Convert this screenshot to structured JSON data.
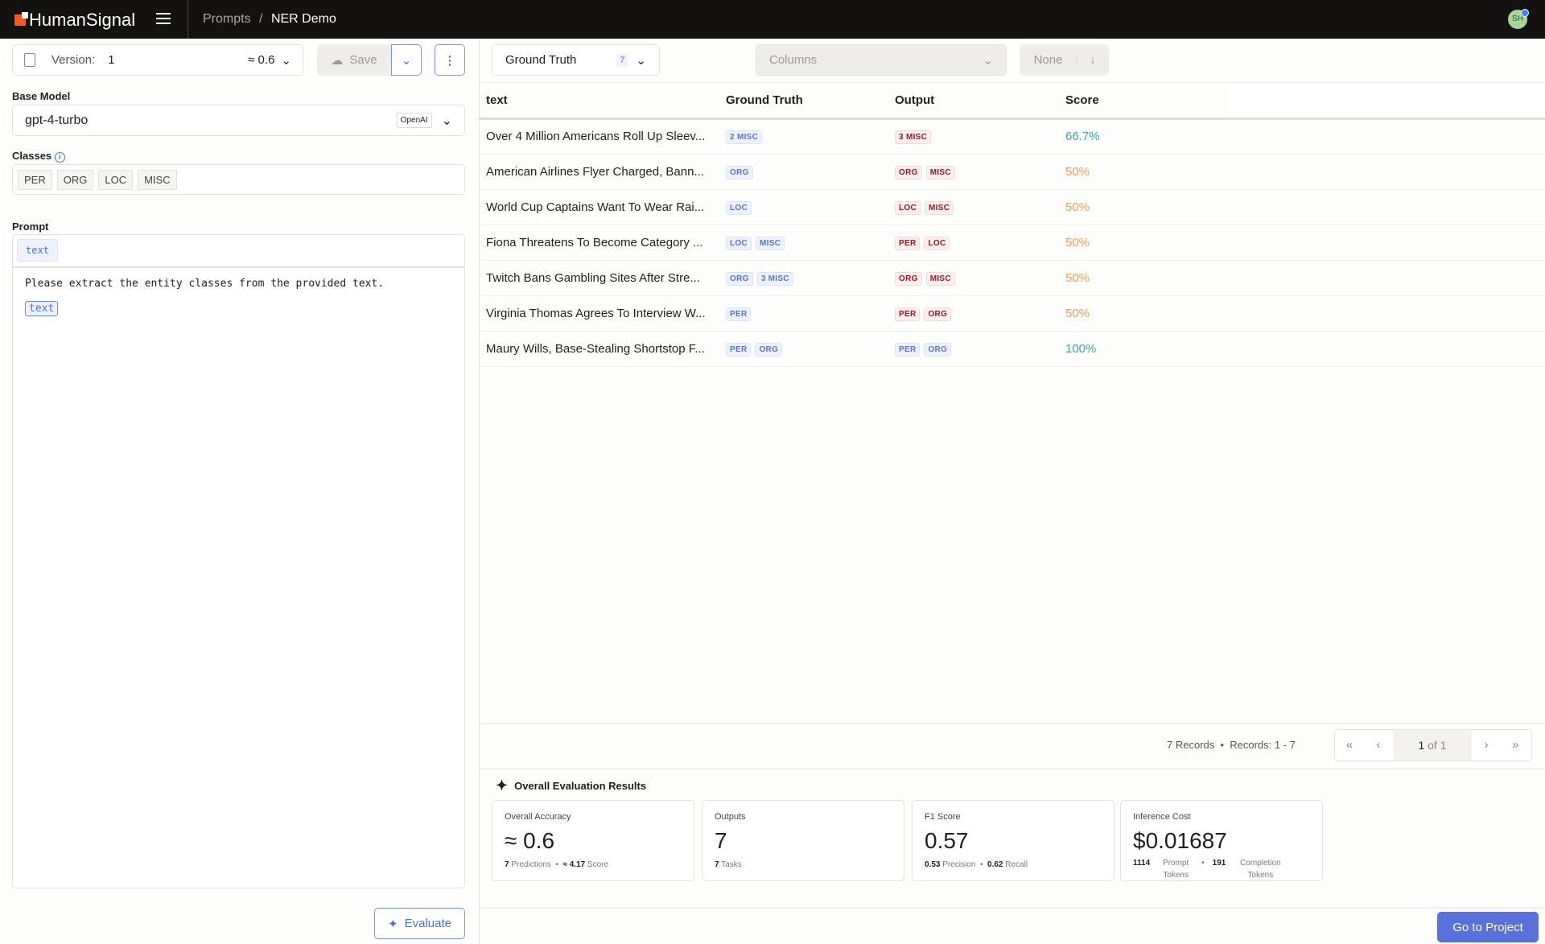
{
  "header": {
    "logo": "HumanSignal",
    "breadcrumb": [
      "Prompts",
      "NER Demo"
    ],
    "separator": "/",
    "avatar": "SH"
  },
  "version": {
    "label": "Version:",
    "value": "1",
    "score": "≈ 0.6",
    "save": "Save"
  },
  "base_model": {
    "label": "Base Model",
    "value": "gpt-4-turbo",
    "provider": "OpenAI"
  },
  "classes": {
    "label": "Classes",
    "items": [
      "PER",
      "ORG",
      "LOC",
      "MISC"
    ]
  },
  "prompt": {
    "label": "Prompt",
    "variable": "text",
    "body": "Please extract the entity classes from the provided text.",
    "inline_var": "text"
  },
  "evaluate": "Evaluate",
  "toolbar": {
    "view": "Ground Truth",
    "view_count": "7",
    "columns_placeholder": "Columns",
    "sort": "None"
  },
  "table": {
    "headers": [
      "text",
      "Ground Truth",
      "Output",
      "Score"
    ],
    "rows": [
      {
        "text": "Over 4 Million Americans Roll Up Sleev...",
        "gt": [
          "2 MISC"
        ],
        "out": [
          "3 MISC"
        ],
        "out_match": [
          false
        ],
        "score": "66.7%",
        "good": true
      },
      {
        "text": "American Airlines Flyer Charged, Bann...",
        "gt": [
          "ORG"
        ],
        "out": [
          "ORG",
          "MISC"
        ],
        "out_match": [
          false,
          false
        ],
        "score": "50%",
        "good": false
      },
      {
        "text": "World Cup Captains Want To Wear Rai...",
        "gt": [
          "LOC"
        ],
        "out": [
          "LOC",
          "MISC"
        ],
        "out_match": [
          false,
          false
        ],
        "score": "50%",
        "good": false
      },
      {
        "text": "Fiona Threatens To Become Category ...",
        "gt": [
          "LOC",
          "MISC"
        ],
        "out": [
          "PER",
          "LOC"
        ],
        "out_match": [
          false,
          false
        ],
        "score": "50%",
        "good": false
      },
      {
        "text": "Twitch Bans Gambling Sites After Stre...",
        "gt": [
          "ORG",
          "3 MISC"
        ],
        "out": [
          "ORG",
          "MISC"
        ],
        "out_match": [
          false,
          false
        ],
        "score": "50%",
        "good": false
      },
      {
        "text": "Virginia Thomas Agrees To Interview W...",
        "gt": [
          "PER"
        ],
        "out": [
          "PER",
          "ORG"
        ],
        "out_match": [
          false,
          false
        ],
        "score": "50%",
        "good": false
      },
      {
        "text": "Maury Wills, Base-Stealing Shortstop F...",
        "gt": [
          "PER",
          "ORG"
        ],
        "out": [
          "PER",
          "ORG"
        ],
        "out_match": [
          true,
          true
        ],
        "score": "100%",
        "good": true
      }
    ]
  },
  "pagination": {
    "records": "7 Records",
    "range": "Records: 1 - 7",
    "page": "1",
    "of": "of 1"
  },
  "results": {
    "title": "Overall Evaluation Results",
    "accuracy": {
      "label": "Overall Accuracy",
      "value": "≈ 0.6",
      "predictions": "7",
      "predictions_label": "Predictions",
      "score": "≈ 4.17",
      "score_label": "Score"
    },
    "outputs": {
      "label": "Outputs",
      "value": "7",
      "tasks": "7",
      "tasks_label": "Tasks"
    },
    "f1": {
      "label": "F1 Score",
      "value": "0.57",
      "precision": "0.53",
      "precision_label": "Precision",
      "recall": "0.62",
      "recall_label": "Recall"
    },
    "cost": {
      "label": "Inference Cost",
      "value": "$0.01687",
      "prompt_tokens": "1114",
      "prompt_label": "Prompt Tokens",
      "completion_tokens": "191",
      "completion_label": "Completion Tokens"
    }
  },
  "go_to_project": "Go to Project",
  "colors": {
    "accent": "#4d6ee0",
    "good": "#3aa99a",
    "warn": "#f39a54"
  }
}
